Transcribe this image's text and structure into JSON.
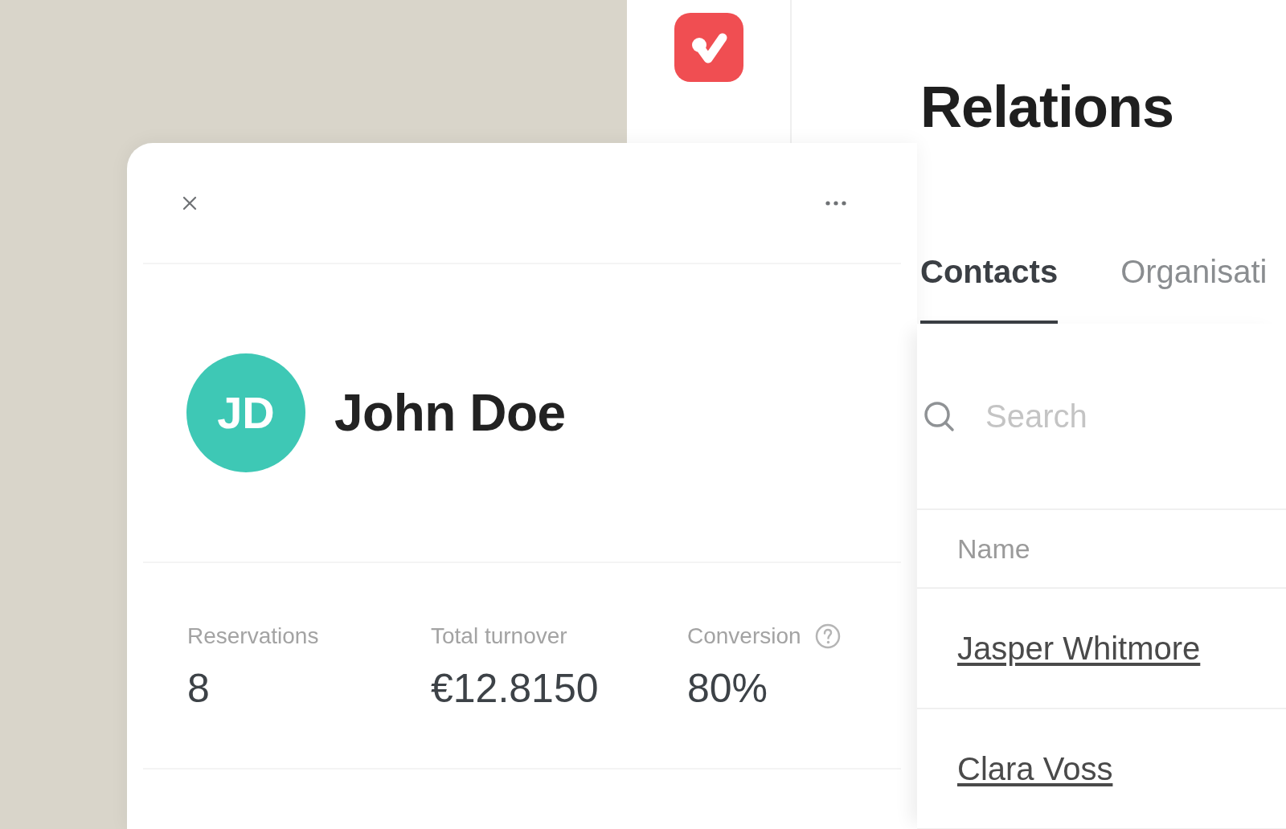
{
  "page": {
    "title": "Relations"
  },
  "tabs": [
    {
      "label": "Contacts",
      "selected": true
    },
    {
      "label": "Organisati",
      "selected": false
    }
  ],
  "search": {
    "placeholder": "Search"
  },
  "table": {
    "columns": [
      "Name"
    ],
    "rows": [
      {
        "name": "Jasper Whitmore"
      },
      {
        "name": "Clara Voss"
      }
    ]
  },
  "contact_panel": {
    "initials": "JD",
    "name": "John Doe",
    "stats": [
      {
        "label": "Reservations",
        "value": "8",
        "help": false
      },
      {
        "label": "Total turnover",
        "value": "€12.8150",
        "help": false
      },
      {
        "label": "Conversion",
        "value": "80%",
        "help": true
      }
    ]
  }
}
